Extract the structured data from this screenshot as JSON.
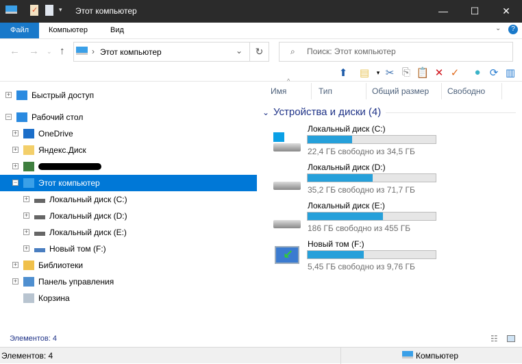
{
  "window": {
    "title": "Этот компьютер",
    "minimize": "—",
    "maximize": "☐",
    "close": "✕"
  },
  "ribbon": {
    "tabs": [
      "Файл",
      "Компьютер",
      "Вид"
    ]
  },
  "address": {
    "path": "Этот компьютер",
    "search_placeholder": "Поиск: Этот компьютер"
  },
  "columns": [
    "Имя",
    "Тип",
    "Общий размер",
    "Свободно"
  ],
  "tree": [
    {
      "label": "Быстрый доступ",
      "icon": "star-icon",
      "level": 0,
      "exp": "+"
    },
    {
      "label": "Рабочий стол",
      "icon": "desktop-icon",
      "level": 0,
      "exp": "−"
    },
    {
      "label": "OneDrive",
      "icon": "cloud-icon",
      "level": 1,
      "exp": "+"
    },
    {
      "label": "Яндекс.Диск",
      "icon": "folder-icon",
      "level": 1,
      "exp": "+"
    },
    {
      "label": "",
      "icon": "user-icon",
      "level": 1,
      "exp": "+"
    },
    {
      "label": "Этот компьютер",
      "icon": "computer-icon",
      "level": 1,
      "exp": "−",
      "selected": true
    },
    {
      "label": "Локальный диск (C:)",
      "icon": "system-drive-icon",
      "level": 2,
      "exp": "+"
    },
    {
      "label": "Локальный диск (D:)",
      "icon": "drive-icon",
      "level": 2,
      "exp": "+"
    },
    {
      "label": "Локальный диск (E:)",
      "icon": "drive-icon",
      "level": 2,
      "exp": "+"
    },
    {
      "label": "Новый том (F:)",
      "icon": "removable-drive-icon",
      "level": 2,
      "exp": "+"
    },
    {
      "label": "Библиотеки",
      "icon": "libraries-icon",
      "level": 1,
      "exp": "+"
    },
    {
      "label": "Панель управления",
      "icon": "control-panel-icon",
      "level": 1,
      "exp": "+"
    },
    {
      "label": "Корзина",
      "icon": "recycle-bin-icon",
      "level": 1,
      "exp": ""
    }
  ],
  "group": {
    "title": "Устройства и диски (4)"
  },
  "drives": [
    {
      "name": "Локальный диск (C:)",
      "free": "22,4 ГБ свободно из 34,5 ГБ",
      "used_fraction": 0.35
    },
    {
      "name": "Локальный диск (D:)",
      "free": "35,2 ГБ свободно из 71,7 ГБ",
      "used_fraction": 0.51
    },
    {
      "name": "Локальный диск (E:)",
      "free": "186 ГБ свободно из 455 ГБ",
      "used_fraction": 0.59
    },
    {
      "name": "Новый том (F:)",
      "free": "5,45 ГБ свободно из 9,76 ГБ",
      "used_fraction": 0.44
    }
  ],
  "status": {
    "items": "Элементов: 4",
    "bottom_items": "Элементов: 4",
    "location": "Компьютер"
  },
  "colors": {
    "accent": "#0078d7",
    "bar": "#26a0da",
    "file_tab": "#1979ca"
  }
}
